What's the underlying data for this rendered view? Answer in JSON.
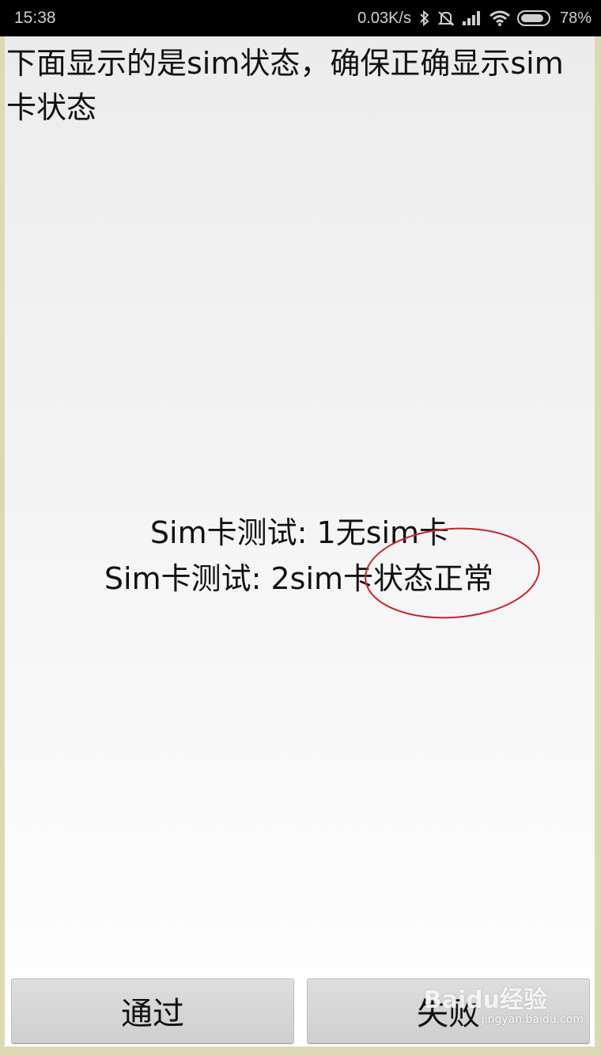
{
  "status_bar": {
    "time": "15:38",
    "network_speed": "0.03K/s",
    "battery_percent": "78%",
    "icons": [
      "bluetooth-icon",
      "mute-icon",
      "signal-icon",
      "wifi-icon",
      "battery-icon"
    ]
  },
  "instruction": "下面显示的是sim状态，确保正确显示sim卡状态",
  "sim_status": {
    "lines": [
      "Sim卡测试: 1无sim卡",
      "Sim卡测试: 2sim卡状态正常"
    ]
  },
  "annotation": {
    "type": "ellipse",
    "color": "#c8252d",
    "target": "状态正常"
  },
  "buttons": {
    "pass_label": "通过",
    "fail_label": "失败"
  },
  "watermark": {
    "logo": "Baidu经验",
    "url": "jingyan.baidu.com"
  }
}
